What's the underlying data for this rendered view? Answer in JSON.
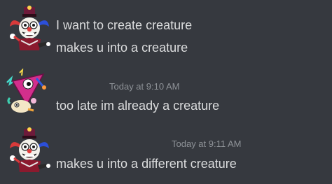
{
  "messages": [
    {
      "avatar": "jester-clown-avatar-icon",
      "lines": [
        "I want to create creature",
        "makes u into a creature"
      ]
    },
    {
      "timestamp": "Today at 9:10 AM",
      "avatar": "pink-triangle-creature-avatar-icon",
      "lines": [
        "too late im already a creature"
      ]
    },
    {
      "timestamp": "Today at 9:11 AM",
      "avatar": "jester-clown-avatar-icon",
      "lines": [
        "makes u into a different creature"
      ]
    }
  ],
  "colors": {
    "background": "#36393f",
    "message_text": "#dcddde",
    "timestamp": "#8e9297"
  }
}
